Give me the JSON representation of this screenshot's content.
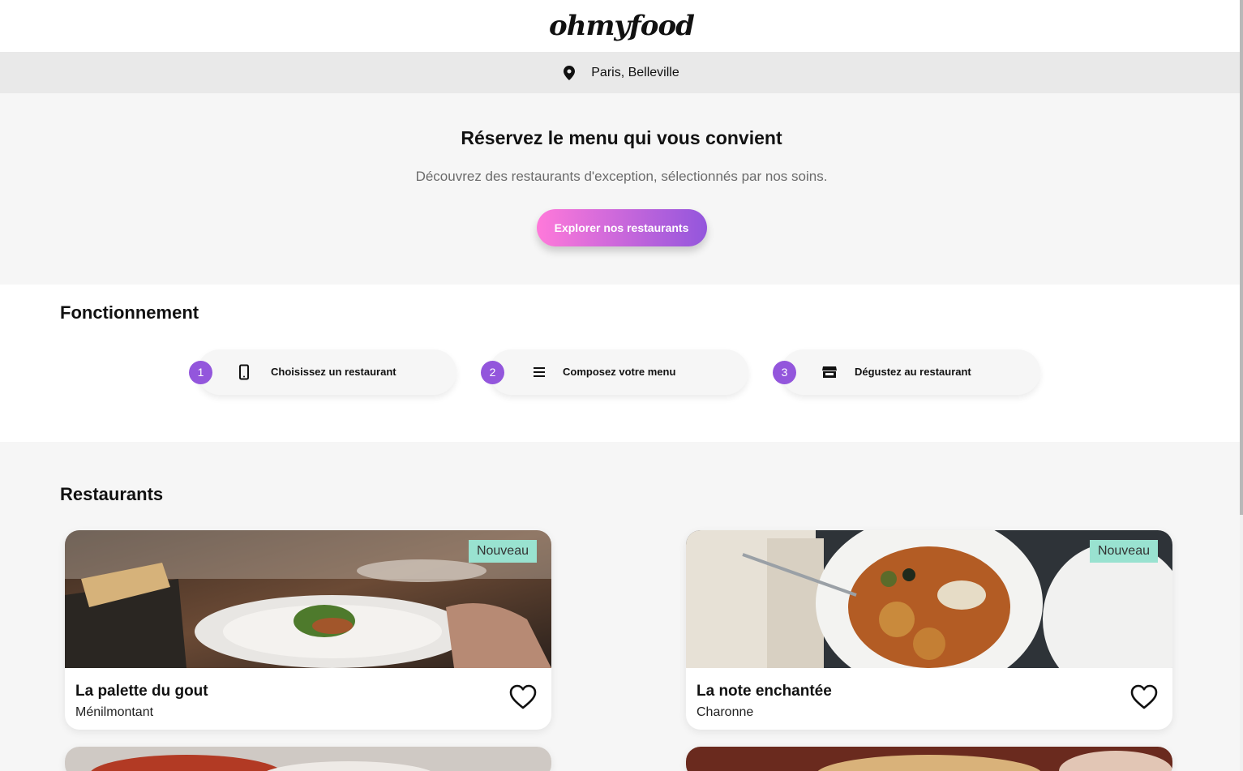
{
  "header": {
    "logo": "ohmyfood"
  },
  "location": {
    "text": "Paris, Belleville",
    "icon": "location-pin-icon"
  },
  "hero": {
    "title": "Réservez le menu qui vous convient",
    "subtitle": "Découvrez des restaurants d'exception, sélectionnés par nos soins.",
    "cta_label": "Explorer nos restaurants"
  },
  "how": {
    "title": "Fonctionnement",
    "steps": [
      {
        "num": "1",
        "label": "Choisissez un restaurant",
        "icon": "smartphone-icon"
      },
      {
        "num": "2",
        "label": "Composez votre menu",
        "icon": "menu-list-icon"
      },
      {
        "num": "3",
        "label": "Dégustez au restaurant",
        "icon": "storefront-icon"
      }
    ]
  },
  "restaurants": {
    "title": "Restaurants",
    "cards": [
      {
        "name": "La palette du gout",
        "area": "Ménilmontant",
        "badge": "Nouveau"
      },
      {
        "name": "La note enchantée",
        "area": "Charonne",
        "badge": "Nouveau"
      }
    ]
  },
  "colors": {
    "accent_purple": "#9356dc",
    "accent_pink": "#ff79da",
    "badge_green": "#99e2d0"
  }
}
